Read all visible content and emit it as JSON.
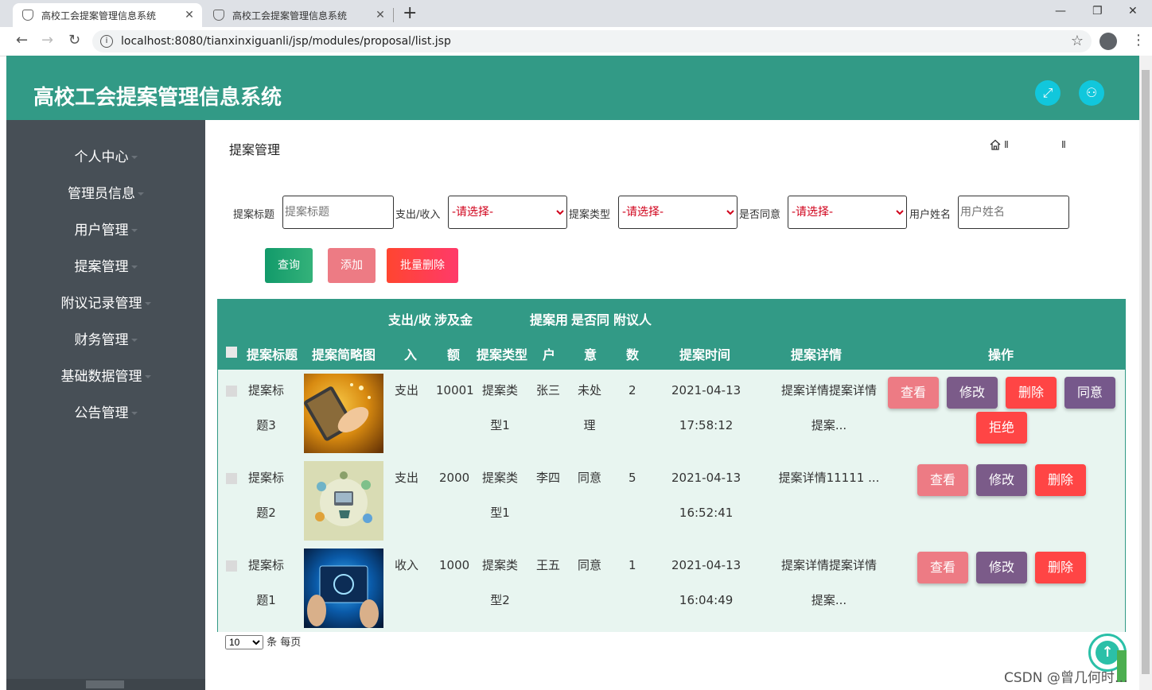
{
  "browser": {
    "tabs": [
      {
        "title": "高校工会提案管理信息系统"
      },
      {
        "title": "高校工会提案管理信息系统"
      }
    ],
    "url": "localhost:8080/tianxinxiguanli/jsp/modules/proposal/list.jsp"
  },
  "app": {
    "title": "高校工会提案管理信息系统"
  },
  "sidebar": {
    "items": [
      {
        "label": "个人中心"
      },
      {
        "label": "管理员信息"
      },
      {
        "label": "用户管理"
      },
      {
        "label": "提案管理"
      },
      {
        "label": "附议记录管理"
      },
      {
        "label": "财务管理"
      },
      {
        "label": "基础数据管理"
      },
      {
        "label": "公告管理"
      }
    ]
  },
  "page": {
    "title": "提案管理",
    "breadcrumb_a": "Ⅱ",
    "breadcrumb_b": "Ⅱ"
  },
  "filters": {
    "title_label": "提案标题",
    "title_placeholder": "提案标题",
    "type_in_out_label": "支出/收入",
    "type_in_out_value": "-请选择-",
    "proposal_type_label": "提案类型",
    "proposal_type_value": "-请选择-",
    "agree_label": "是否同意",
    "agree_value": "-请选择-",
    "username_label": "用户姓名",
    "username_placeholder": "用户姓名"
  },
  "actions": {
    "query": "查询",
    "add": "添加",
    "batch_delete": "批量删除"
  },
  "table": {
    "headers": {
      "title": "提案标题",
      "image": "提案简略图",
      "inout_top": "支出/收",
      "inout_bottom": "入",
      "amount_top": "涉及金",
      "amount_bottom": "额",
      "type": "提案类型",
      "user_top": "提案用",
      "user_bottom": "户",
      "agree_top": "是否同",
      "agree_bottom": "意",
      "count_top": "附议人",
      "count_bottom": "数",
      "time": "提案时间",
      "detail": "提案详情",
      "ops": "操作"
    },
    "rows": [
      {
        "title_l1": "提案标",
        "title_l2": "题3",
        "inout": "支出",
        "amount": "10001",
        "type_l1": "提案类",
        "type_l2": "型1",
        "user": "张三",
        "agree_l1": "未处",
        "agree_l2": "理",
        "count": "2",
        "time_l1": "2021-04-13",
        "time_l2": "17:58:12",
        "detail_l1": "提案详情提案详情",
        "detail_l2": "提案..."
      },
      {
        "title_l1": "提案标",
        "title_l2": "题2",
        "inout": "支出",
        "amount": "2000",
        "type_l1": "提案类",
        "type_l2": "型1",
        "user": "李四",
        "agree_l1": "同意",
        "agree_l2": "",
        "count": "5",
        "time_l1": "2021-04-13",
        "time_l2": "16:52:41",
        "detail_l1": "提案详情11111 ...",
        "detail_l2": ""
      },
      {
        "title_l1": "提案标",
        "title_l2": "题1",
        "inout": "收入",
        "amount": "1000",
        "type_l1": "提案类",
        "type_l2": "型2",
        "user": "王五",
        "agree_l1": "同意",
        "agree_l2": "",
        "count": "1",
        "time_l1": "2021-04-13",
        "time_l2": "16:04:49",
        "detail_l1": "提案详情提案详情",
        "detail_l2": "提案..."
      }
    ],
    "op_labels": {
      "view": "查看",
      "edit": "修改",
      "delete": "删除",
      "agree": "同意",
      "reject": "拒绝"
    }
  },
  "pager": {
    "page_size": "10",
    "suffix": "条 每页"
  },
  "watermark": "CSDN @曾几何时…",
  "colors": {
    "header": "#329a86",
    "sidebar": "#474f56",
    "view": "#ed7b84",
    "edit": "#7b5b89",
    "delete": "#ff4545"
  }
}
